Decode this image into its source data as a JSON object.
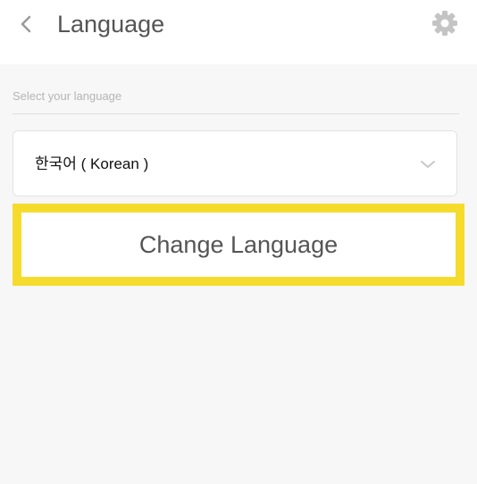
{
  "header": {
    "title": "Language"
  },
  "language_select": {
    "label": "Select your language",
    "selected": "한국어 ( Korean )"
  },
  "change_button": {
    "label": "Change Language"
  },
  "colors": {
    "highlight_border": "#f5dc2c",
    "background": "#f7f7f7"
  },
  "icons": {
    "back": "back-arrow-icon",
    "settings": "gear-icon",
    "dropdown": "chevron-down-icon"
  }
}
